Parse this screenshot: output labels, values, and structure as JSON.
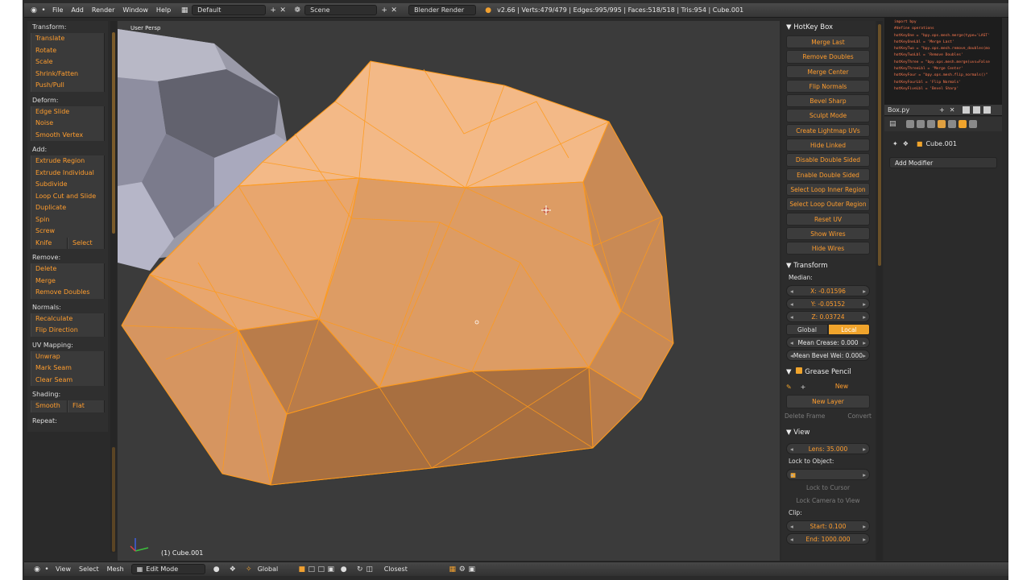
{
  "topbar": {
    "menus": [
      "File",
      "Add",
      "Render",
      "Window",
      "Help"
    ],
    "screen_layout": "Default",
    "scene": "Scene",
    "engine": "Blender Render",
    "stats": "v2.66 | Verts:479/479 | Edges:995/995 | Faces:518/518 | Tris:954 | Cube.001"
  },
  "toolshelf": {
    "transform": {
      "title": "Transform:",
      "items": [
        "Translate",
        "Rotate",
        "Scale",
        "Shrink/Fatten",
        "Push/Pull"
      ]
    },
    "deform": {
      "title": "Deform:",
      "items": [
        "Edge Slide",
        "Noise",
        "Smooth Vertex"
      ]
    },
    "add": {
      "title": "Add:",
      "items": [
        "Extrude Region",
        "Extrude Individual",
        "Subdivide",
        "Loop Cut and Slide",
        "Duplicate",
        "Spin",
        "Screw"
      ],
      "knife": "Knife",
      "select": "Select"
    },
    "remove": {
      "title": "Remove:",
      "items": [
        "Delete",
        "Merge",
        "Remove Doubles"
      ]
    },
    "normals": {
      "title": "Normals:",
      "items": [
        "Recalculate",
        "Flip Direction"
      ]
    },
    "uv": {
      "title": "UV Mapping:",
      "items": [
        "Unwrap",
        "Mark Seam",
        "Clear Seam"
      ]
    },
    "shading": {
      "title": "Shading:",
      "smooth": "Smooth",
      "flat": "Flat"
    },
    "repeat": {
      "title": "Repeat:"
    }
  },
  "viewport": {
    "view_label": "User Persp",
    "object_label": "(1) Cube.001"
  },
  "hotkey_box": {
    "title": "HotKey Box",
    "buttons": [
      "Merge Last",
      "Remove Doubles",
      "Merge Center",
      "Flip Normals",
      "Bevel Sharp",
      "Sculpt Mode",
      "Create Lightmap UVs",
      "Hide Linked",
      "Disable Double Sided",
      "Enable Double Sided",
      "Select Loop Inner Region",
      "Select Loop Outer Region",
      "Reset UV",
      "Show Wires",
      "Hide Wires"
    ]
  },
  "transform_panel": {
    "title": "Transform",
    "median_label": "Median:",
    "x": "X: -0.01596",
    "y": "Y: -0.05152",
    "z": "Z: 0.03724",
    "global": "Global",
    "local": "Local",
    "mean_crease": "Mean Crease: 0.000",
    "mean_bevel": "Mean Bevel Wei: 0.000"
  },
  "grease_pencil": {
    "title": "Grease Pencil",
    "new": "New",
    "new_layer": "New Layer",
    "delete_frame": "Delete Frame",
    "convert": "Convert"
  },
  "view_panel": {
    "title": "View",
    "lens": "Lens: 35.000",
    "lock_to_object": "Lock to Object:",
    "lock_to_cursor": "Lock to Cursor",
    "lock_camera": "Lock Camera to View",
    "clip": "Clip:",
    "start": "Start: 0.100",
    "end": "End: 1000.000"
  },
  "text_editor": {
    "filename": "Box.py",
    "lines": [
      "import bpy",
      "#define operations",
      "hotKeyOne = \"bpy.ops.mesh.merge(type='LAST'",
      "hotKeyOneLbl = 'Merge Last'",
      "hotKeyTwo = \"bpy.ops.mesh.remove_doubles(mo",
      "hotKeyTwoLbl = 'Remove Doubles'",
      "hotKeyThree = \"bpy.ops.mesh.merge(uvs=False",
      "hotKeyThreeLbl = 'Merge Center'",
      "hotKeyFour = \"bpy.ops.mesh.flip_normals()\"",
      "hotKeyFourLbl = 'Flip Normals'",
      "hotKeyFiveLbl = 'Bevel Sharp'"
    ]
  },
  "properties": {
    "object_name": "Cube.001",
    "add_modifier": "Add Modifier"
  },
  "bottombar": {
    "view": "View",
    "select": "Select",
    "mesh": "Mesh",
    "mode": "Edit Mode",
    "orientation": "Global",
    "snap": "Closest"
  },
  "colors": {
    "accent": "#ff9d2e",
    "mesh_face": "#e8a66c",
    "mesh_wire": "#ff9a1a",
    "viewport_bg": "#3b3b3b"
  }
}
